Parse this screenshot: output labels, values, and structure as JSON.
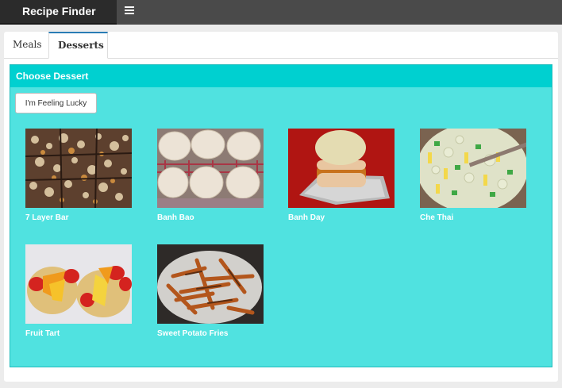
{
  "app": {
    "title": "Recipe Finder",
    "menu_icon": "hamburger-icon"
  },
  "tabs": [
    {
      "label": "Meals",
      "active": false
    },
    {
      "label": "Desserts",
      "active": true
    }
  ],
  "panel": {
    "title": "Choose Dessert",
    "lucky_button": "I'm Feeling Lucky"
  },
  "desserts": [
    {
      "name": "7 Layer Bar"
    },
    {
      "name": "Banh Bao"
    },
    {
      "name": "Banh Day"
    },
    {
      "name": "Che Thai"
    },
    {
      "name": "Fruit Tart"
    },
    {
      "name": "Sweet Potato Fries"
    }
  ],
  "colors": {
    "accent": "#00d0d0",
    "panel_bg": "#50e2e0",
    "topbar": "#4a4a4a",
    "brand_bg": "#2b2b2b"
  }
}
